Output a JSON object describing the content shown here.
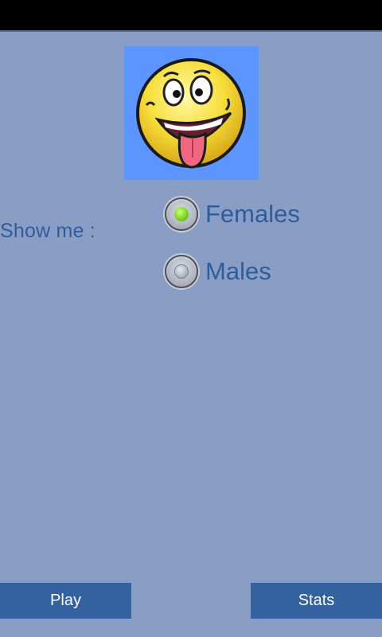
{
  "form": {
    "show_label": "Show me :",
    "options": [
      {
        "label": "Females",
        "selected": true
      },
      {
        "label": "Males",
        "selected": false
      }
    ]
  },
  "buttons": {
    "play": "Play",
    "stats": "Stats"
  },
  "logo": {
    "icon": "smiley-tongue-icon"
  },
  "colors": {
    "background": "#8a9dc5",
    "text": "#2e5d9c",
    "button": "#3461a0",
    "logo_bg": "#5c95fd"
  }
}
